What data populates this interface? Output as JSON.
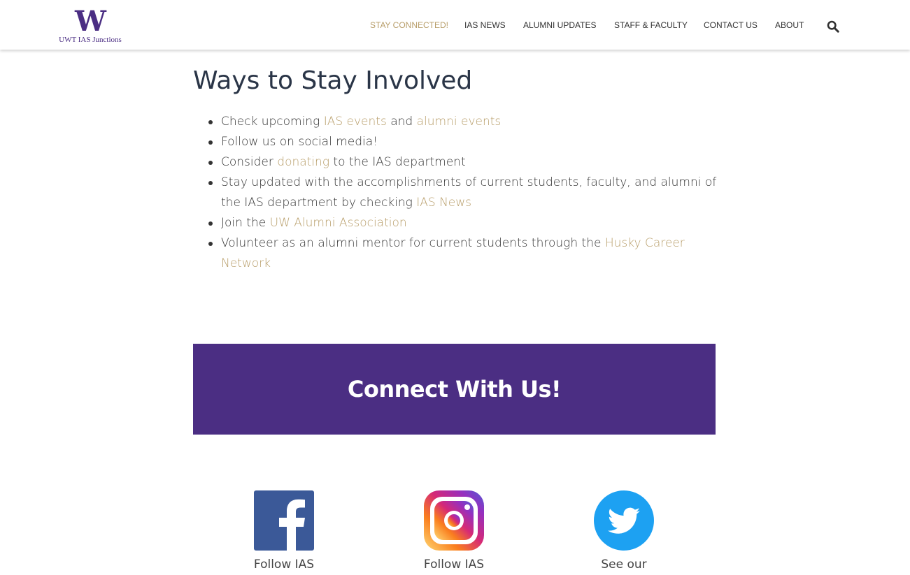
{
  "logo": {
    "mark": "W",
    "subtitle": "UWT IAS Junctions"
  },
  "nav": {
    "items": [
      "STAY CONNECTED!",
      "IAS NEWS",
      "ALUMNI UPDATES",
      "STAFF & FACULTY",
      "CONTACT US",
      "ABOUT"
    ],
    "active": "STAY CONNECTED!",
    "search_icon": "search-icon"
  },
  "content": {
    "title": "Ways to Stay Involved",
    "items": [
      {
        "pre": "Check upcoming ",
        "link1": "IAS events",
        "mid": " and ",
        "link2": "alumni events"
      },
      {
        "text": "Follow us on social media!"
      },
      {
        "pre": "Consider ",
        "link": "donating",
        "post": " to the IAS department"
      },
      {
        "pre": "Stay updated with the accomplishments of current students, faculty, and alumni of the IAS department by checking ",
        "link": "IAS News"
      },
      {
        "pre": "Join the ",
        "link": "UW Alumni Association"
      },
      {
        "pre": "Volunteer as an alumni mentor for current students through the ",
        "link": "Husky Career Network"
      }
    ]
  },
  "banner": {
    "title": "Connect With Us!"
  },
  "social": [
    {
      "icon": "facebook-icon",
      "label": "Follow IAS"
    },
    {
      "icon": "instagram-icon",
      "label": "Follow IAS"
    },
    {
      "icon": "twitter-icon",
      "label": "See our"
    }
  ],
  "colors": {
    "brand_purple": "#4b2e83",
    "link_gold": "#b89e6a",
    "heading": "#2a3547",
    "facebook": "#3b5998",
    "twitter": "#1da1f2"
  }
}
